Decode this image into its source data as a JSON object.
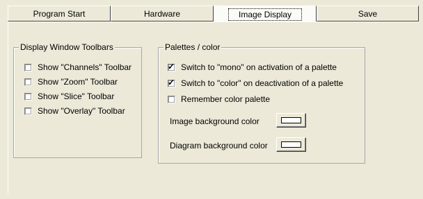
{
  "tabs": [
    {
      "label": "Program Start",
      "active": false
    },
    {
      "label": "Hardware",
      "active": false
    },
    {
      "label": "Image Display",
      "active": true
    },
    {
      "label": "Save",
      "active": false
    }
  ],
  "toolbars_group": {
    "title": "Display Window Toolbars",
    "options": [
      {
        "label": "Show \"Channels\" Toolbar",
        "checked": false
      },
      {
        "label": "Show \"Zoom\" Toolbar",
        "checked": false
      },
      {
        "label": "Show \"Slice\" Toolbar",
        "checked": false
      },
      {
        "label": "Show \"Overlay\" Toolbar",
        "checked": false
      }
    ]
  },
  "palettes_group": {
    "title": "Palettes / color",
    "options": [
      {
        "label": "Switch to \"mono\" on activation of a palette",
        "checked": true
      },
      {
        "label": "Switch to \"color\" on deactivation of a palette",
        "checked": true
      },
      {
        "label": "Remember color palette",
        "checked": false
      }
    ],
    "image_bg_label": "Image background color",
    "image_bg_color": "#ffffff",
    "diagram_bg_label": "Diagram background color",
    "diagram_bg_color": "#ffffff"
  },
  "colors": {
    "face": "#ece9d8",
    "active_tab": "#fbfbf8"
  }
}
